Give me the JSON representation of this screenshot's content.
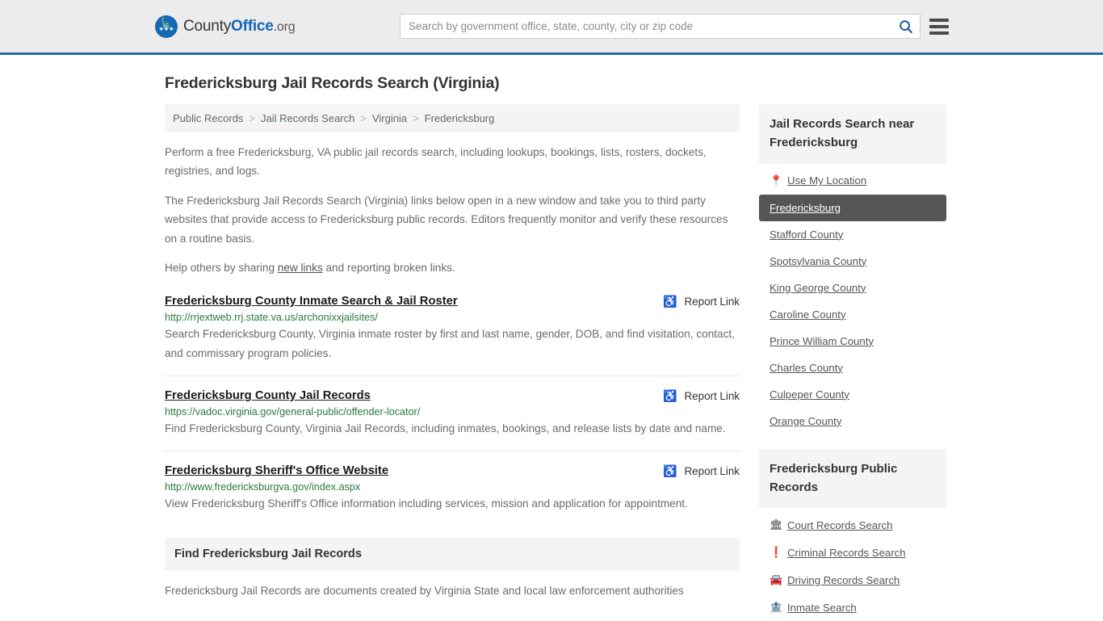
{
  "header": {
    "brand": {
      "part1": "County",
      "part2": "Office",
      "part3": ".org",
      "badge_eagle": "eagle-icon",
      "badge_stars": "★★★"
    },
    "search": {
      "placeholder": "Search by government office, state, county, city or zip code",
      "value": "",
      "icon": "search-icon"
    },
    "menu_icon": "hamburger-menu-icon",
    "colors": {
      "bar_bg": "#ececec",
      "accent_border": "#2c6ca5",
      "brand_blue": "#1668b3"
    }
  },
  "page": {
    "title": "Fredericksburg Jail Records Search (Virginia)"
  },
  "breadcrumb": {
    "separator": ">",
    "items": [
      {
        "label": "Public Records"
      },
      {
        "label": "Jail Records Search"
      },
      {
        "label": "Virginia"
      },
      {
        "label": "Fredericksburg"
      }
    ]
  },
  "intro": {
    "paragraph1": "Perform a free Fredericksburg, VA public jail records search, including lookups, bookings, lists, rosters, dockets, registries, and logs.",
    "paragraph2": "The Fredericksburg Jail Records Search (Virginia) links below open in a new window and take you to third party websites that provide access to Fredericksburg public records. Editors frequently monitor and verify these resources on a routine basis.",
    "paragraph3_before": "Help others by sharing ",
    "paragraph3_link": "new links",
    "paragraph3_after": " and reporting broken links."
  },
  "results": {
    "report_label": "Report Link",
    "report_icon": "broken-link-icon",
    "items": [
      {
        "title": "Fredericksburg County Inmate Search & Jail Roster",
        "url": "http://rrjextweb.rrj.state.va.us/archonixxjailsites/",
        "description": "Search Fredericksburg County, Virginia inmate roster by first and last name, gender, DOB, and find visitation, contact, and commissary program policies."
      },
      {
        "title": "Fredericksburg County Jail Records",
        "url": "https://vadoc.virginia.gov/general-public/offender-locator/",
        "description": "Find Fredericksburg County, Virginia Jail Records, including inmates, bookings, and release lists by date and name."
      },
      {
        "title": "Fredericksburg Sheriff's Office Website",
        "url": "http://www.fredericksburgva.gov/index.aspx",
        "description": "View Fredericksburg Sheriff's Office information including services, mission and application for appointment."
      }
    ]
  },
  "find_section": {
    "heading": "Find Fredericksburg Jail Records",
    "body": "Fredericksburg Jail Records are documents created by Virginia State and local law enforcement authorities"
  },
  "sidebar": {
    "nearby": {
      "heading": "Jail Records Search near Fredericksburg",
      "items": [
        {
          "label": "Use My Location",
          "icon": "map-pin-icon",
          "active": false
        },
        {
          "label": "Fredericksburg",
          "icon": "",
          "active": true
        },
        {
          "label": "Stafford County",
          "icon": "",
          "active": false
        },
        {
          "label": "Spotsylvania County",
          "icon": "",
          "active": false
        },
        {
          "label": "King George County",
          "icon": "",
          "active": false
        },
        {
          "label": "Caroline County",
          "icon": "",
          "active": false
        },
        {
          "label": "Prince William County",
          "icon": "",
          "active": false
        },
        {
          "label": "Charles County",
          "icon": "",
          "active": false
        },
        {
          "label": "Culpeper County",
          "icon": "",
          "active": false
        },
        {
          "label": "Orange County",
          "icon": "",
          "active": false
        }
      ]
    },
    "public_records": {
      "heading": "Fredericksburg Public Records",
      "items": [
        {
          "label": "Court Records Search",
          "icon": "courthouse-icon"
        },
        {
          "label": "Criminal Records Search",
          "icon": "exclamation-icon"
        },
        {
          "label": "Driving Records Search",
          "icon": "car-icon"
        },
        {
          "label": "Inmate Search",
          "icon": "jail-icon"
        }
      ]
    },
    "colors": {
      "card_bg": "#f4f4f4",
      "active_bg": "#555555"
    }
  }
}
